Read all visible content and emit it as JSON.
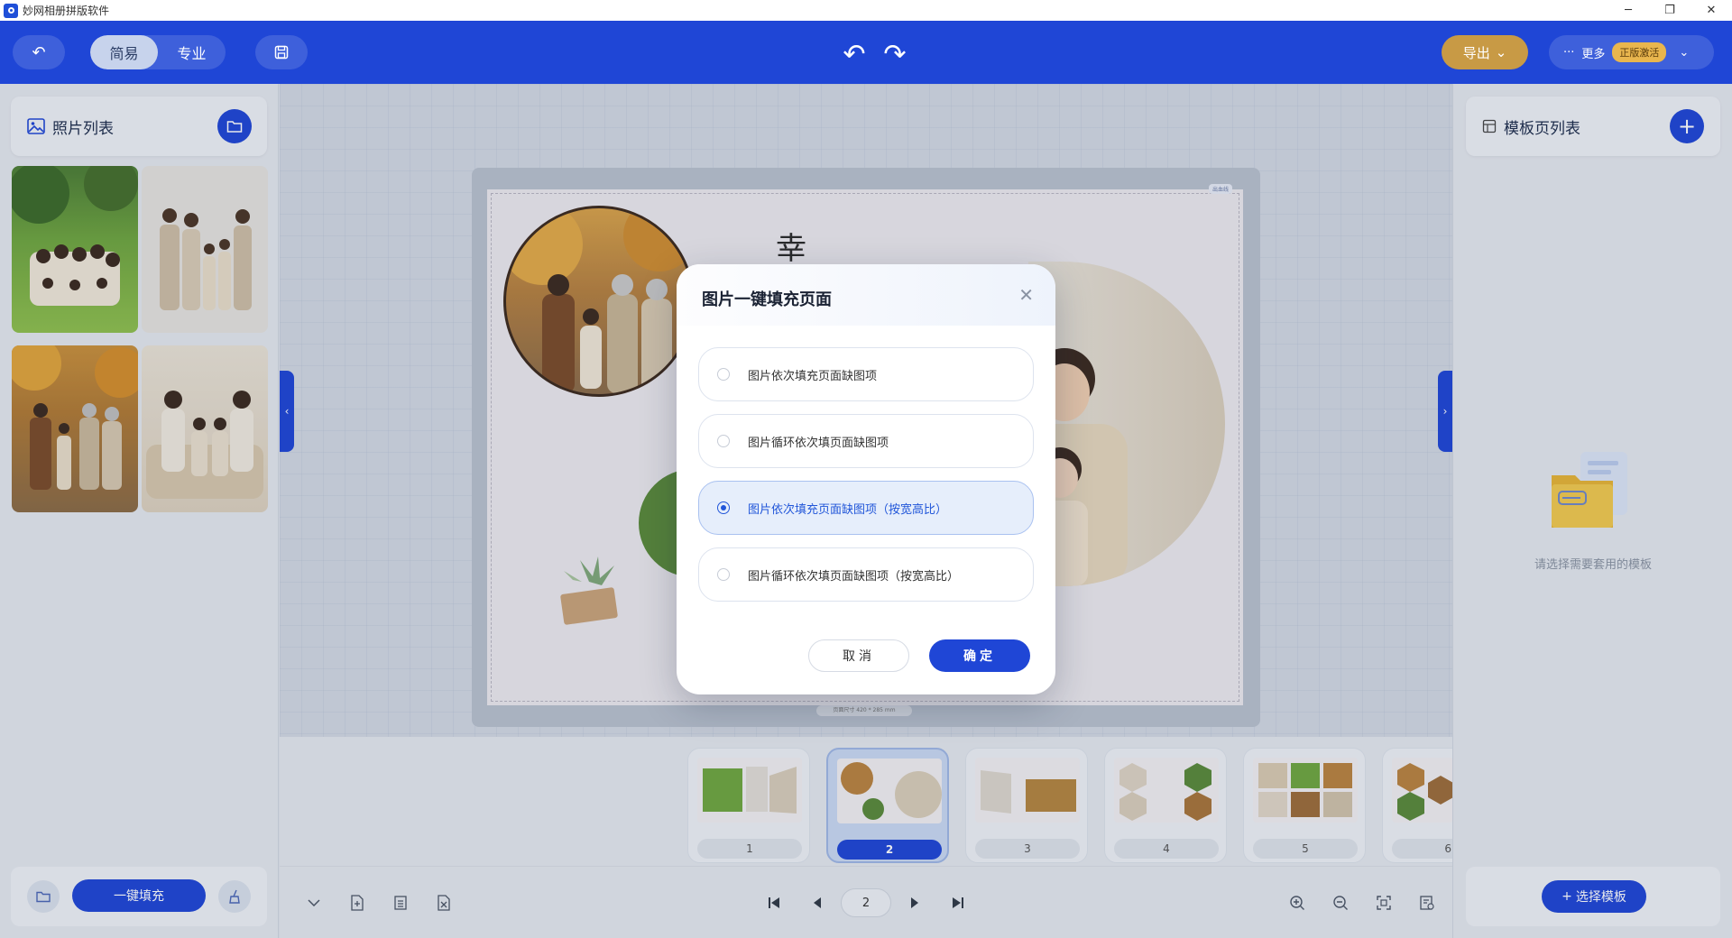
{
  "window": {
    "title": "妙网相册拼版软件",
    "minimize": "─",
    "maximize": "❐",
    "close": "✕"
  },
  "toolbar": {
    "back_icon": "↶",
    "mode_simple": "简易",
    "mode_pro": "专业",
    "save_icon": "💾",
    "undo_icon": "↶",
    "redo_icon": "↷",
    "export_label": "导出",
    "export_caret": "⌄",
    "more_dots": "···",
    "more_label": "更多",
    "activate_badge": "正版激活",
    "more_caret": "⌄"
  },
  "left_panel": {
    "title": "照片列表",
    "photos": [
      "family-park",
      "family-studio",
      "family-autumn",
      "family-sofa"
    ],
    "fill_button": "一键填充"
  },
  "right_panel": {
    "title": "模板页列表",
    "empty_text": "请选择需要套用的模板",
    "select_button": "选择模板"
  },
  "canvas": {
    "page_text_char": "幸",
    "size_label": "页面尺寸 420 * 285 mm",
    "corner_label": "出血线"
  },
  "dialog": {
    "title": "图片一键填充页面",
    "close_icon": "✕",
    "options": [
      {
        "label": "图片依次填充页面缺图项",
        "selected": false
      },
      {
        "label": "图片循环依次填页面缺图项",
        "selected": false
      },
      {
        "label": "图片依次填充页面缺图项（按宽高比）",
        "selected": true
      },
      {
        "label": "图片循环依次填页面缺图项（按宽高比）",
        "selected": false
      }
    ],
    "cancel": "取消",
    "confirm": "确定"
  },
  "pages": [
    {
      "num": "1",
      "active": false
    },
    {
      "num": "2",
      "active": true
    },
    {
      "num": "3",
      "active": false
    },
    {
      "num": "4",
      "active": false
    },
    {
      "num": "5",
      "active": false
    },
    {
      "num": "6",
      "active": false
    }
  ],
  "pager": {
    "current": "2"
  },
  "colors": {
    "primary": "#1f46d6",
    "export": "#c89a45",
    "badge": "#e9b64e",
    "panel": "#e4e8ef"
  }
}
